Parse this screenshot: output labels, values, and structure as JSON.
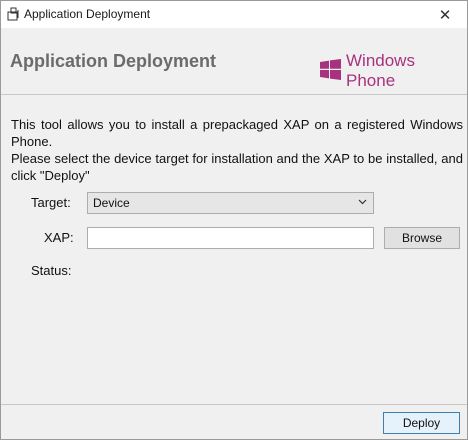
{
  "window": {
    "title": "Application Deployment",
    "close_glyph": "✕"
  },
  "header": {
    "title": "Application Deployment",
    "logo_text": "Windows Phone",
    "logo_color": "#a8327e"
  },
  "description": {
    "line1": "This tool allows you to install a prepackaged XAP on a registered Windows Phone.",
    "line2": "Please select the device target for installation and the XAP to be installed, and click \"Deploy\""
  },
  "form": {
    "target_label": "Target:",
    "target_value": "Device",
    "xap_label": "XAP:",
    "xap_value": "",
    "browse_label": "Browse",
    "status_label": "Status:"
  },
  "footer": {
    "deploy_label": "Deploy"
  },
  "icons": {
    "app": "app-package-icon",
    "close": "close-icon",
    "logo": "windows-logo-icon",
    "dropdown": "chevron-down-icon"
  }
}
